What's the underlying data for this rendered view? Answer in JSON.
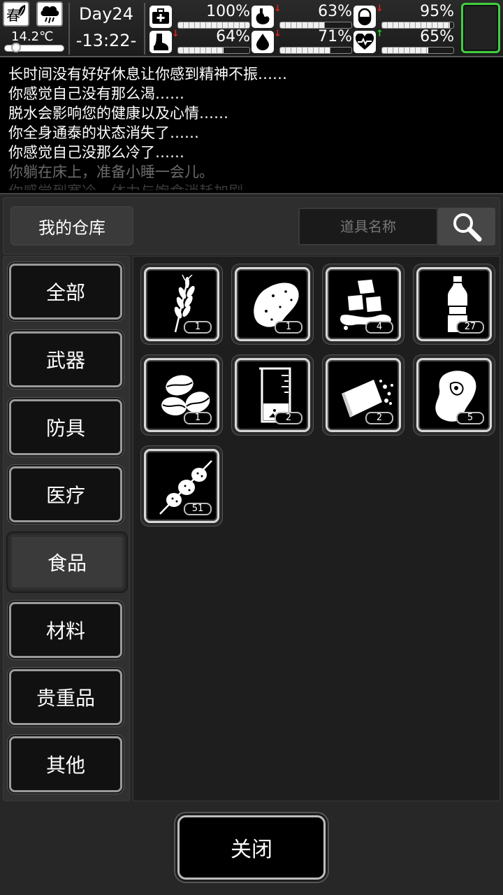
{
  "status": {
    "season": "春",
    "weather_icon": "cloud-rain-icon",
    "temperature": "14.2℃",
    "temperature_level": 0.15,
    "day": "Day24",
    "time": "-13:22-",
    "stats": [
      {
        "id": "health",
        "icon": "medkit-icon",
        "value": "100%",
        "level": 1.0,
        "trend": ""
      },
      {
        "id": "hunger",
        "icon": "stomach-icon",
        "value": "63%",
        "level": 0.63,
        "trend": "down"
      },
      {
        "id": "medicine",
        "icon": "pill-icon",
        "value": "95%",
        "level": 0.95,
        "trend": "down"
      },
      {
        "id": "stamina",
        "icon": "boot-icon",
        "value": "64%",
        "level": 0.64,
        "trend": "down"
      },
      {
        "id": "thirst",
        "icon": "water-drop-icon",
        "value": "71%",
        "level": 0.71,
        "trend": "down"
      },
      {
        "id": "mood",
        "icon": "heart-icon",
        "value": "65%",
        "level": 0.65,
        "trend": "up"
      }
    ]
  },
  "log": [
    {
      "text": "长时间没有好好休息让你感到精神不振……",
      "tone": "normal"
    },
    {
      "text": "你感觉自己没有那么渴……",
      "tone": "normal"
    },
    {
      "text": "脱水会影响您的健康以及心情……",
      "tone": "normal"
    },
    {
      "text": "你全身通泰的状态消失了……",
      "tone": "normal"
    },
    {
      "text": "你感觉自己没那么冷了……",
      "tone": "normal"
    },
    {
      "text": "你躺在床上，准备小睡一会儿。",
      "tone": "dim1"
    },
    {
      "text": "你感觉到寒冷，体力与饱食消耗加剧。",
      "tone": "dim2"
    }
  ],
  "warehouse": {
    "title": "我的仓库",
    "search_placeholder": "道具名称",
    "categories": [
      "全部",
      "武器",
      "防具",
      "医疗",
      "食品",
      "材料",
      "贵重品",
      "其他"
    ],
    "selected_category": "食品",
    "items": [
      {
        "icon": "wheat-icon",
        "qty": "1"
      },
      {
        "icon": "potato-icon",
        "qty": "1"
      },
      {
        "icon": "ice-cubes-icon",
        "qty": "4"
      },
      {
        "icon": "water-bottle-icon",
        "qty": "27"
      },
      {
        "icon": "coffee-beans-icon",
        "qty": "1"
      },
      {
        "icon": "beaker-icon",
        "qty": "2"
      },
      {
        "icon": "bread-bar-icon",
        "qty": "2"
      },
      {
        "icon": "steak-icon",
        "qty": "5"
      },
      {
        "icon": "meat-skewer-icon",
        "qty": "51"
      }
    ],
    "close_label": "关闭"
  },
  "colors": {
    "slot_border": "#3fcf3f",
    "trend_down": "#e02020",
    "trend_up": "#20d020"
  }
}
